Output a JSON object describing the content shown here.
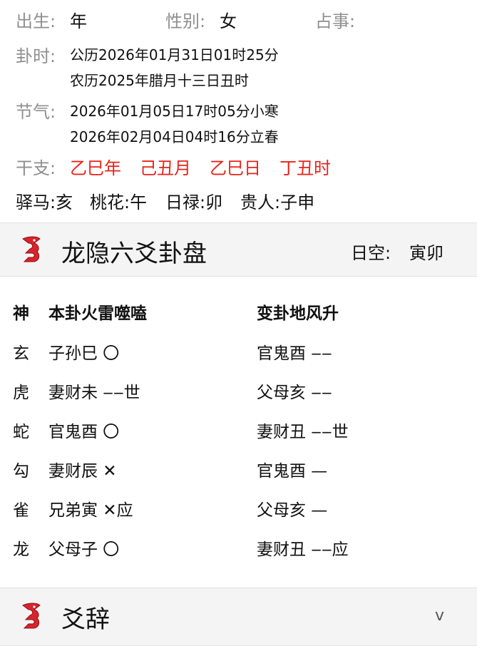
{
  "info": {
    "birth_label": "出生:",
    "birth_value": "年",
    "gender_label": "性别:",
    "gender_value": "女",
    "matter_label": "占事:",
    "matter_value": "",
    "time_label": "卦时:",
    "time_solar": "公历2026年01月31日01时25分",
    "time_lunar": "农历2025年腊月十三日丑时",
    "solar_term_label": "节气:",
    "solar_term_1": "2026年01月05日17时05分小寒",
    "solar_term_2": "2026年02月04日04时16分立春",
    "ganzhi_label": "干支:",
    "ganzhi": [
      "乙巳年",
      "己丑月",
      "乙巳日",
      "丁丑时"
    ],
    "stars": [
      "驿马:亥",
      "桃花:午",
      "日禄:卯",
      "贵人:子申"
    ]
  },
  "panel": {
    "title": "龙隐六爻卦盘",
    "rikong_label": "日空:",
    "rikong_value": "寅卯"
  },
  "hexagram": {
    "header": {
      "god": "神",
      "main": "本卦火雷噬嗑",
      "changed": "变卦地风升"
    },
    "rows": [
      {
        "god": "玄",
        "main": "子孙巳 〇",
        "changed": "官鬼酉 ‒‒"
      },
      {
        "god": "虎",
        "main": "妻财未 ‒‒世",
        "changed": "父母亥 ‒‒"
      },
      {
        "god": "蛇",
        "main": "官鬼酉 〇",
        "changed": "妻财丑 ‒‒世"
      },
      {
        "god": "勾",
        "main": "妻财辰 ✕",
        "changed": "官鬼酉 —"
      },
      {
        "god": "雀",
        "main": "兄弟寅 ✕应",
        "changed": "父母亥 —"
      },
      {
        "god": "龙",
        "main": "父母子 〇",
        "changed": "妻财丑 ‒‒应"
      }
    ]
  },
  "yaoci": {
    "title": "爻辞",
    "chevron": "v"
  },
  "colors": {
    "accent_red": "#e8231b",
    "label_gray": "#8f8f8f",
    "band_bg": "#f4f4f4"
  },
  "icons": {
    "logo": "dragon-logo-icon",
    "chevron": "chevron-down-icon"
  }
}
